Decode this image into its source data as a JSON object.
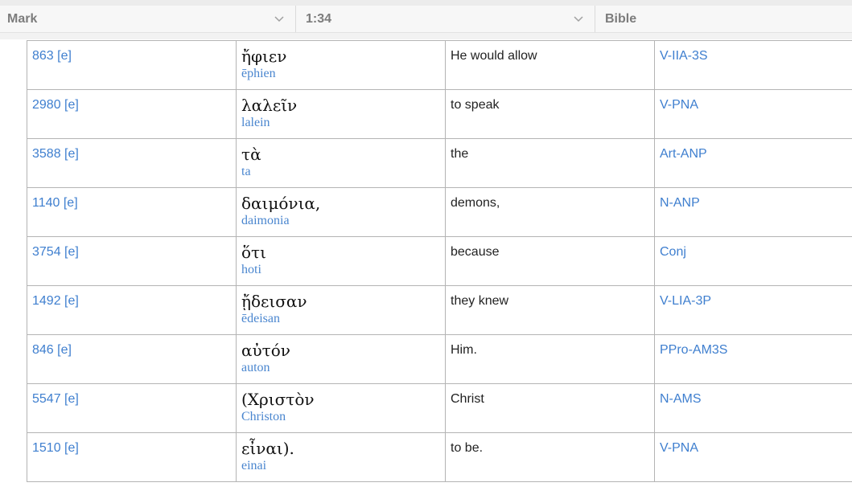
{
  "selectors": {
    "book": "Mark",
    "chapter_verse": "1:34",
    "bible": "Bible"
  },
  "rows": [
    {
      "strongs": "863 [e]",
      "greek": "ἤφιεν",
      "translit": "ēphien",
      "english": "He would allow",
      "parsing": "V-IIA-3S"
    },
    {
      "strongs": "2980 [e]",
      "greek": "λαλεῖν",
      "translit": "lalein",
      "english": "to speak",
      "parsing": "V-PNA"
    },
    {
      "strongs": "3588 [e]",
      "greek": "τὰ",
      "translit": "ta",
      "english": "the",
      "parsing": "Art-ANP"
    },
    {
      "strongs": "1140 [e]",
      "greek": "δαιμόνια,",
      "translit": "daimonia",
      "english": "demons,",
      "parsing": "N-ANP"
    },
    {
      "strongs": "3754 [e]",
      "greek": "ὅτι",
      "translit": "hoti",
      "english": "because",
      "parsing": "Conj"
    },
    {
      "strongs": "1492 [e]",
      "greek": "ᾔδεισαν",
      "translit": "ēdeisan",
      "english": "they knew",
      "parsing": "V-LIA-3P"
    },
    {
      "strongs": "846 [e]",
      "greek": "αὐτόν",
      "translit": "auton",
      "english": "Him.",
      "parsing": "PPro-AM3S"
    },
    {
      "strongs": "5547 [e]",
      "greek": "(Χριστὸν",
      "translit": "Christon",
      "english": "Christ",
      "parsing": "N-AMS"
    },
    {
      "strongs": "1510 [e]",
      "greek": "εἶναι).",
      "translit": "einai",
      "english": "to be.",
      "parsing": "V-PNA"
    }
  ]
}
